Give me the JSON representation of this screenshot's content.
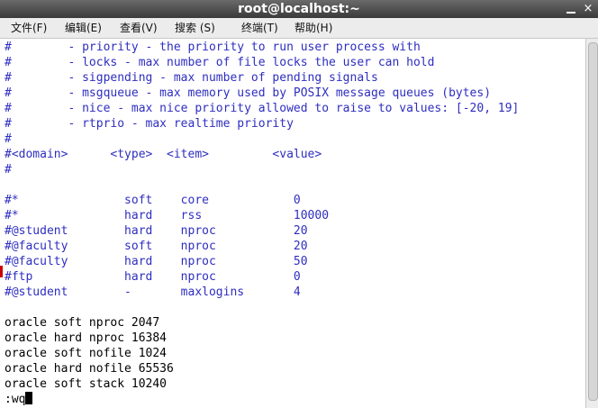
{
  "window": {
    "title": "root@localhost:~",
    "close_glyph": "×"
  },
  "menu": [
    {
      "label": "文件(F)"
    },
    {
      "label": "编辑(E)"
    },
    {
      "label": "查看(V)"
    },
    {
      "label": "搜索 (S)"
    },
    {
      "label": "终端(T)"
    },
    {
      "label": "帮助(H)"
    }
  ],
  "lines": [
    "#        - priority - the priority to run user process with",
    "#        - locks - max number of file locks the user can hold",
    "#        - sigpending - max number of pending signals",
    "#        - msgqueue - max memory used by POSIX message queues (bytes)",
    "#        - nice - max nice priority allowed to raise to values: [-20, 19]",
    "#        - rtprio - max realtime priority",
    "#",
    "#<domain>      <type>  <item>         <value>",
    "#",
    "",
    "#*               soft    core            0",
    "#*               hard    rss             10000",
    "#@student        hard    nproc           20",
    "#@faculty        soft    nproc           20",
    "#@faculty        hard    nproc           50",
    "#ftp             hard    nproc           0",
    "#@student        -       maxlogins       4",
    "",
    "oracle soft nproc 2047",
    "oracle hard nproc 16384",
    "oracle soft nofile 1024",
    "oracle hard nofile 65536",
    "oracle soft stack 10240",
    ":wq"
  ],
  "colors": {
    "comment": "#2e2ec0",
    "text": "#000000",
    "titlebar": "#4a4a4a"
  }
}
